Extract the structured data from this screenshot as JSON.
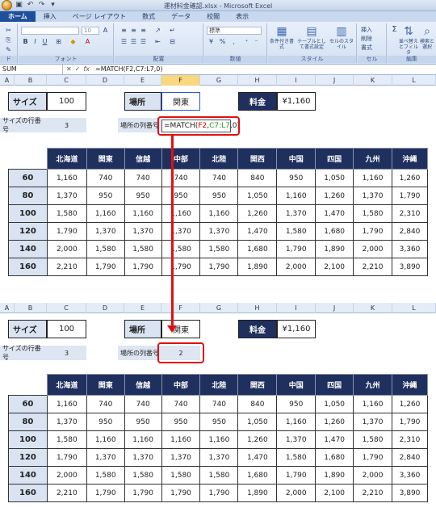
{
  "window": {
    "title": "運材料金確認.xlsx - Microsoft Excel"
  },
  "ribbon": {
    "tabs": [
      "ホーム",
      "挿入",
      "ページ レイアウト",
      "数式",
      "データ",
      "校閲",
      "表示"
    ],
    "groups": {
      "clipboard": "ド",
      "font": "フォント",
      "alignment": "配置",
      "number": "数値",
      "style": "スタイル",
      "cells": "セル",
      "edit": "編集"
    },
    "font_size": "10",
    "number_format": "標準",
    "buttons": {
      "conditional": "条件付き書式",
      "table": "テーブルとして書式設定",
      "cell_style": "セルのスタイル",
      "insert": "挿入",
      "delete": "削除",
      "format": "書式",
      "sort": "並べ替えとフィルタ",
      "find": "検索と選択"
    }
  },
  "formula_bar": {
    "name_box": "SUM",
    "formula": "=MATCH(F2,C7:L7,0)"
  },
  "columns": [
    "A",
    "B",
    "C",
    "D",
    "E",
    "F",
    "G",
    "H",
    "I",
    "J",
    "K",
    "L"
  ],
  "top": {
    "size_label": "サイズ",
    "size_value": "100",
    "place_label": "場所",
    "place_value": "関東",
    "fee_label": "料金",
    "fee_value": "¥1,160",
    "size_row_label": "サイズの行番号",
    "size_row_value": "3",
    "place_col_label": "場所の列番号",
    "formula_parts": {
      "a": "=MATCH(",
      "b": "F2",
      "c": ",",
      "d": "C7:L7",
      "e": ",0)"
    }
  },
  "bottom": {
    "size_label": "サイズ",
    "size_value": "100",
    "place_label": "場所",
    "place_value": "関東",
    "fee_label": "料金",
    "fee_value": "¥1,160",
    "size_row_label": "サイズの行番号",
    "size_row_value": "3",
    "place_col_label": "場所の列番号",
    "place_col_value": "2"
  },
  "table": {
    "regions": [
      "北海道",
      "関東",
      "信越",
      "中部",
      "北陸",
      "関西",
      "中国",
      "四国",
      "九州",
      "沖縄"
    ],
    "rows": [
      {
        "size": "60",
        "values": [
          "1,160",
          "740",
          "740",
          "740",
          "740",
          "840",
          "950",
          "1,050",
          "1,160",
          "1,260"
        ]
      },
      {
        "size": "80",
        "values": [
          "1,370",
          "950",
          "950",
          "950",
          "950",
          "1,050",
          "1,160",
          "1,260",
          "1,370",
          "1,790"
        ]
      },
      {
        "size": "100",
        "values": [
          "1,580",
          "1,160",
          "1,160",
          "1,160",
          "1,160",
          "1,260",
          "1,370",
          "1,470",
          "1,580",
          "2,310"
        ]
      },
      {
        "size": "120",
        "values": [
          "1,790",
          "1,370",
          "1,370",
          "1,370",
          "1,370",
          "1,470",
          "1,580",
          "1,680",
          "1,790",
          "2,840"
        ]
      },
      {
        "size": "140",
        "values": [
          "2,000",
          "1,580",
          "1,580",
          "1,580",
          "1,580",
          "1,680",
          "1,790",
          "1,890",
          "2,000",
          "3,360"
        ]
      },
      {
        "size": "160",
        "values": [
          "2,210",
          "1,790",
          "1,790",
          "1,790",
          "1,790",
          "1,890",
          "2,000",
          "2,100",
          "2,210",
          "3,890"
        ]
      }
    ]
  }
}
